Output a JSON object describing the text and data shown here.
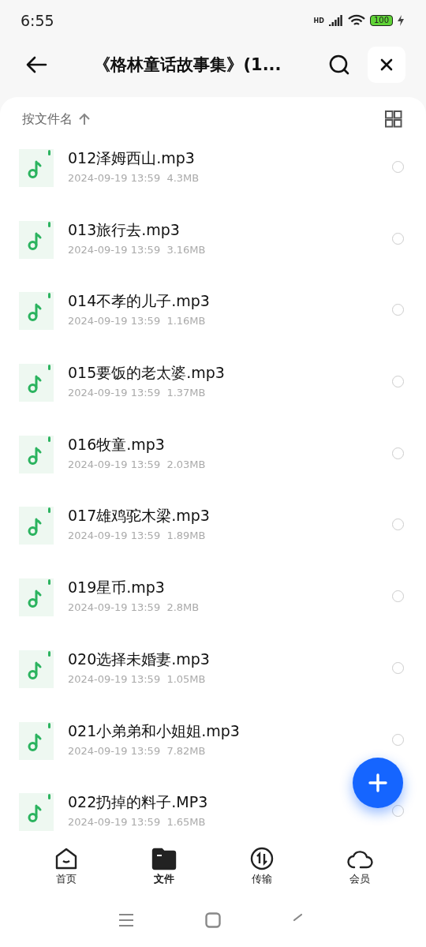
{
  "status_bar": {
    "time": "6:55",
    "network": "HD",
    "battery": "100"
  },
  "header": {
    "title": "《格林童话故事集》(1..."
  },
  "sort": {
    "label": "按文件名"
  },
  "files": [
    {
      "name": "012泽姆西山.mp3",
      "date": "2024-09-19 13:59",
      "size": "4.3MB",
      "selected": false
    },
    {
      "name": "013旅行去.mp3",
      "date": "2024-09-19 13:59",
      "size": "3.16MB",
      "selected": false
    },
    {
      "name": "014不孝的儿子.mp3",
      "date": "2024-09-19 13:59",
      "size": "1.16MB",
      "selected": false
    },
    {
      "name": "015要饭的老太婆.mp3",
      "date": "2024-09-19 13:59",
      "size": "1.37MB",
      "selected": false
    },
    {
      "name": "016牧童.mp3",
      "date": "2024-09-19 13:59",
      "size": "2.03MB",
      "selected": false
    },
    {
      "name": "017雄鸡驼木梁.mp3",
      "date": "2024-09-19 13:59",
      "size": "1.89MB",
      "selected": false
    },
    {
      "name": "019星币.mp3",
      "date": "2024-09-19 13:59",
      "size": "2.8MB",
      "selected": false
    },
    {
      "name": "020选择未婚妻.mp3",
      "date": "2024-09-19 13:59",
      "size": "1.05MB",
      "selected": false
    },
    {
      "name": "021小弟弟和小姐姐.mp3",
      "date": "2024-09-19 13:59",
      "size": "7.82MB",
      "selected": false
    },
    {
      "name": "022扔掉的料子.MP3",
      "date": "2024-09-19 13:59",
      "size": "1.65MB",
      "selected": false
    }
  ],
  "bottom_nav": [
    {
      "label": "首页",
      "kind": "home",
      "selected": false
    },
    {
      "label": "文件",
      "kind": "files",
      "selected": true
    },
    {
      "label": "传输",
      "kind": "transfer",
      "selected": false
    },
    {
      "label": "会员",
      "kind": "vip",
      "selected": false
    }
  ]
}
